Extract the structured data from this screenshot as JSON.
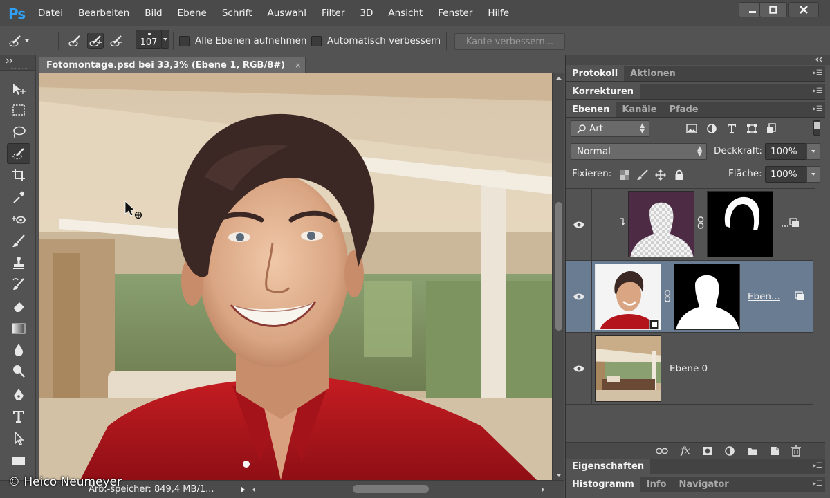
{
  "app": {
    "logo": "Ps"
  },
  "menu": [
    "Datei",
    "Bearbeiten",
    "Bild",
    "Ebene",
    "Schrift",
    "Auswahl",
    "Filter",
    "3D",
    "Ansicht",
    "Fenster",
    "Hilfe"
  ],
  "options": {
    "brush_size": "107",
    "sample_all_label": "Alle Ebenen aufnehmen",
    "auto_enhance_label": "Automatisch verbessern",
    "refine_edge_label": "Kante verbessern..."
  },
  "document": {
    "tab_title": "Fotomontage.psd bei 33,3% (Ebene 1, RGB/8#)",
    "close_glyph": "×",
    "status": "Arb.-speicher: 849,4 MB/1...",
    "copyright": "© Heico Neumeyer"
  },
  "panels": {
    "group1_tabs": [
      "Protokoll",
      "Aktionen"
    ],
    "group2_tabs": [
      "Korrekturen"
    ],
    "layers_tabs": [
      "Ebenen",
      "Kanäle",
      "Pfade"
    ],
    "filter_kind": "Art",
    "blend_mode": "Normal",
    "opacity_label": "Deckkraft:",
    "opacity_value": "100%",
    "lock_label": "Fixieren:",
    "fill_label": "Fläche:",
    "fill_value": "100%",
    "bottom1_tabs": [
      "Eigenschaften"
    ],
    "bottom2_tabs": [
      "Histogramm",
      "Info",
      "Navigator"
    ]
  },
  "layers": [
    {
      "name": "",
      "visible": true,
      "selected": false
    },
    {
      "name": "Eben...",
      "visible": true,
      "selected": true
    },
    {
      "name": "Ebene 0",
      "visible": true,
      "selected": false
    }
  ],
  "colors": {
    "ps_blue": "#2fa0f5",
    "selected_layer": "#6a7c92",
    "shirt_red": "#b4141c"
  }
}
